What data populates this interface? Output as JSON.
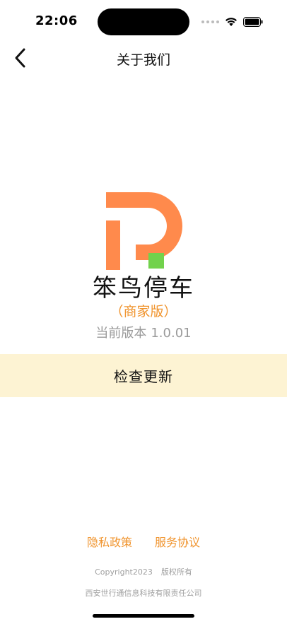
{
  "status_bar": {
    "time": "22:06"
  },
  "nav": {
    "title": "关于我们"
  },
  "brand": {
    "name": "笨鸟停车",
    "subtitle": "（商家版）",
    "version_label": "当前版本",
    "version_number": "1.0.01",
    "logo_color": "#FF8A4C",
    "logo_accent_color": "#72D24C"
  },
  "update": {
    "label": "检查更新",
    "background": "#FDF3D3"
  },
  "links": {
    "privacy": "隐私政策",
    "service": "服务协议"
  },
  "footer": {
    "copyright": "Copyright2023",
    "rights": "版权所有",
    "company": "西安世行通信息科技有限责任公司"
  },
  "colors": {
    "accent": "#F0942E"
  }
}
